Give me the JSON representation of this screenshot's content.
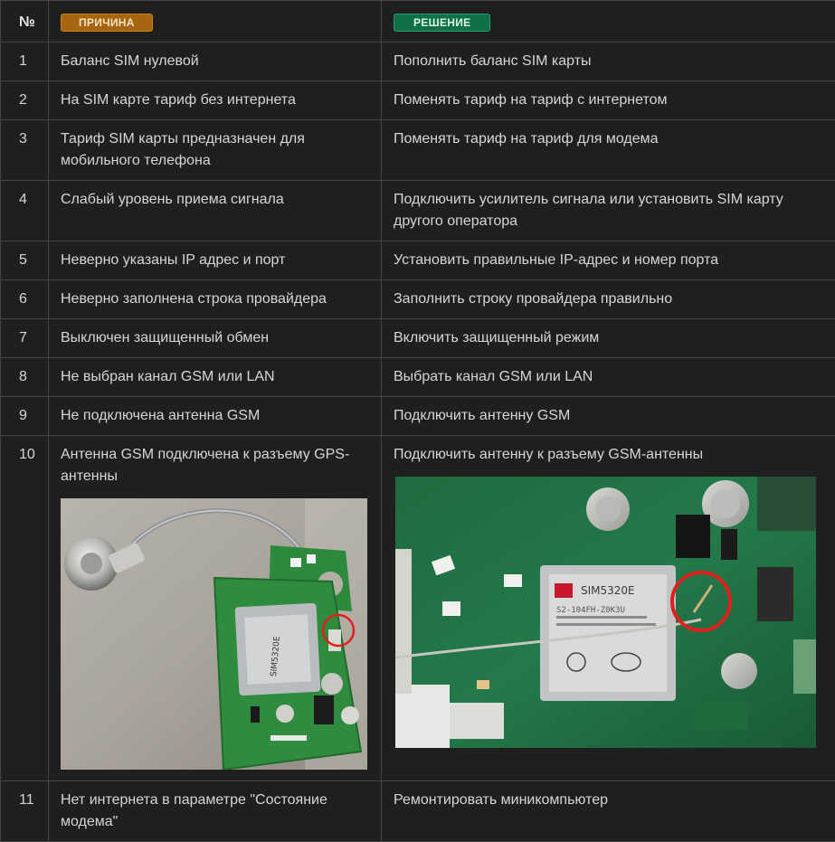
{
  "header": {
    "num": "№",
    "cause": "ПРИЧИНА",
    "solution": "РЕШЕНИЕ"
  },
  "rows": [
    {
      "num": "1",
      "cause": "Баланс SIM нулевой",
      "solution": "Пополнить баланс SIM карты"
    },
    {
      "num": "2",
      "cause": "На SIM карте тариф без интернета",
      "solution": "Поменять тариф на тариф с интернетом"
    },
    {
      "num": "3",
      "cause": "Тариф SIM карты предназначен для мобильного телефона",
      "solution": "Поменять тариф на тариф для модема"
    },
    {
      "num": "4",
      "cause": "Слабый уровень приема сигнала",
      "solution": "Подключить усилитель сигнала или установить SIM карту другого оператора"
    },
    {
      "num": "5",
      "cause": "Неверно указаны IP адрес и порт",
      "solution": "Установить правильные IP-адрес и номер порта"
    },
    {
      "num": "6",
      "cause": "Неверно заполнена строка провайдера",
      "solution": "Заполнить строку провайдера правильно"
    },
    {
      "num": "7",
      "cause": "Выключен защищенный обмен",
      "solution": "Включить защищенный режим"
    },
    {
      "num": "8",
      "cause": "Не выбран канал GSM или LAN",
      "solution": "Выбрать канал GSM или LAN"
    },
    {
      "num": "9",
      "cause": "Не подключена антенна GSM",
      "solution": "Подключить антенну GSM"
    },
    {
      "num": "10",
      "cause": "Антенна GSM подключена к разъему GPS-антенны",
      "solution": "Подключить антенну к разъему GSM-антенны"
    },
    {
      "num": "11",
      "cause": "Нет интернета в параметре \"Состояние модема\"",
      "solution": "Ремонтировать миникомпьютер"
    }
  ],
  "photos": {
    "wrong": {
      "chip_label": "SIM5320E"
    },
    "right": {
      "chip_label": "SIM5320E",
      "model_line": "S2-104FH-Z0K3U"
    }
  },
  "colors": {
    "background": "#1e1f1e",
    "border": "#444544",
    "cause_badge": "#a8650f",
    "solution_badge": "#0f6f47",
    "highlight_circle": "#e0201c"
  }
}
